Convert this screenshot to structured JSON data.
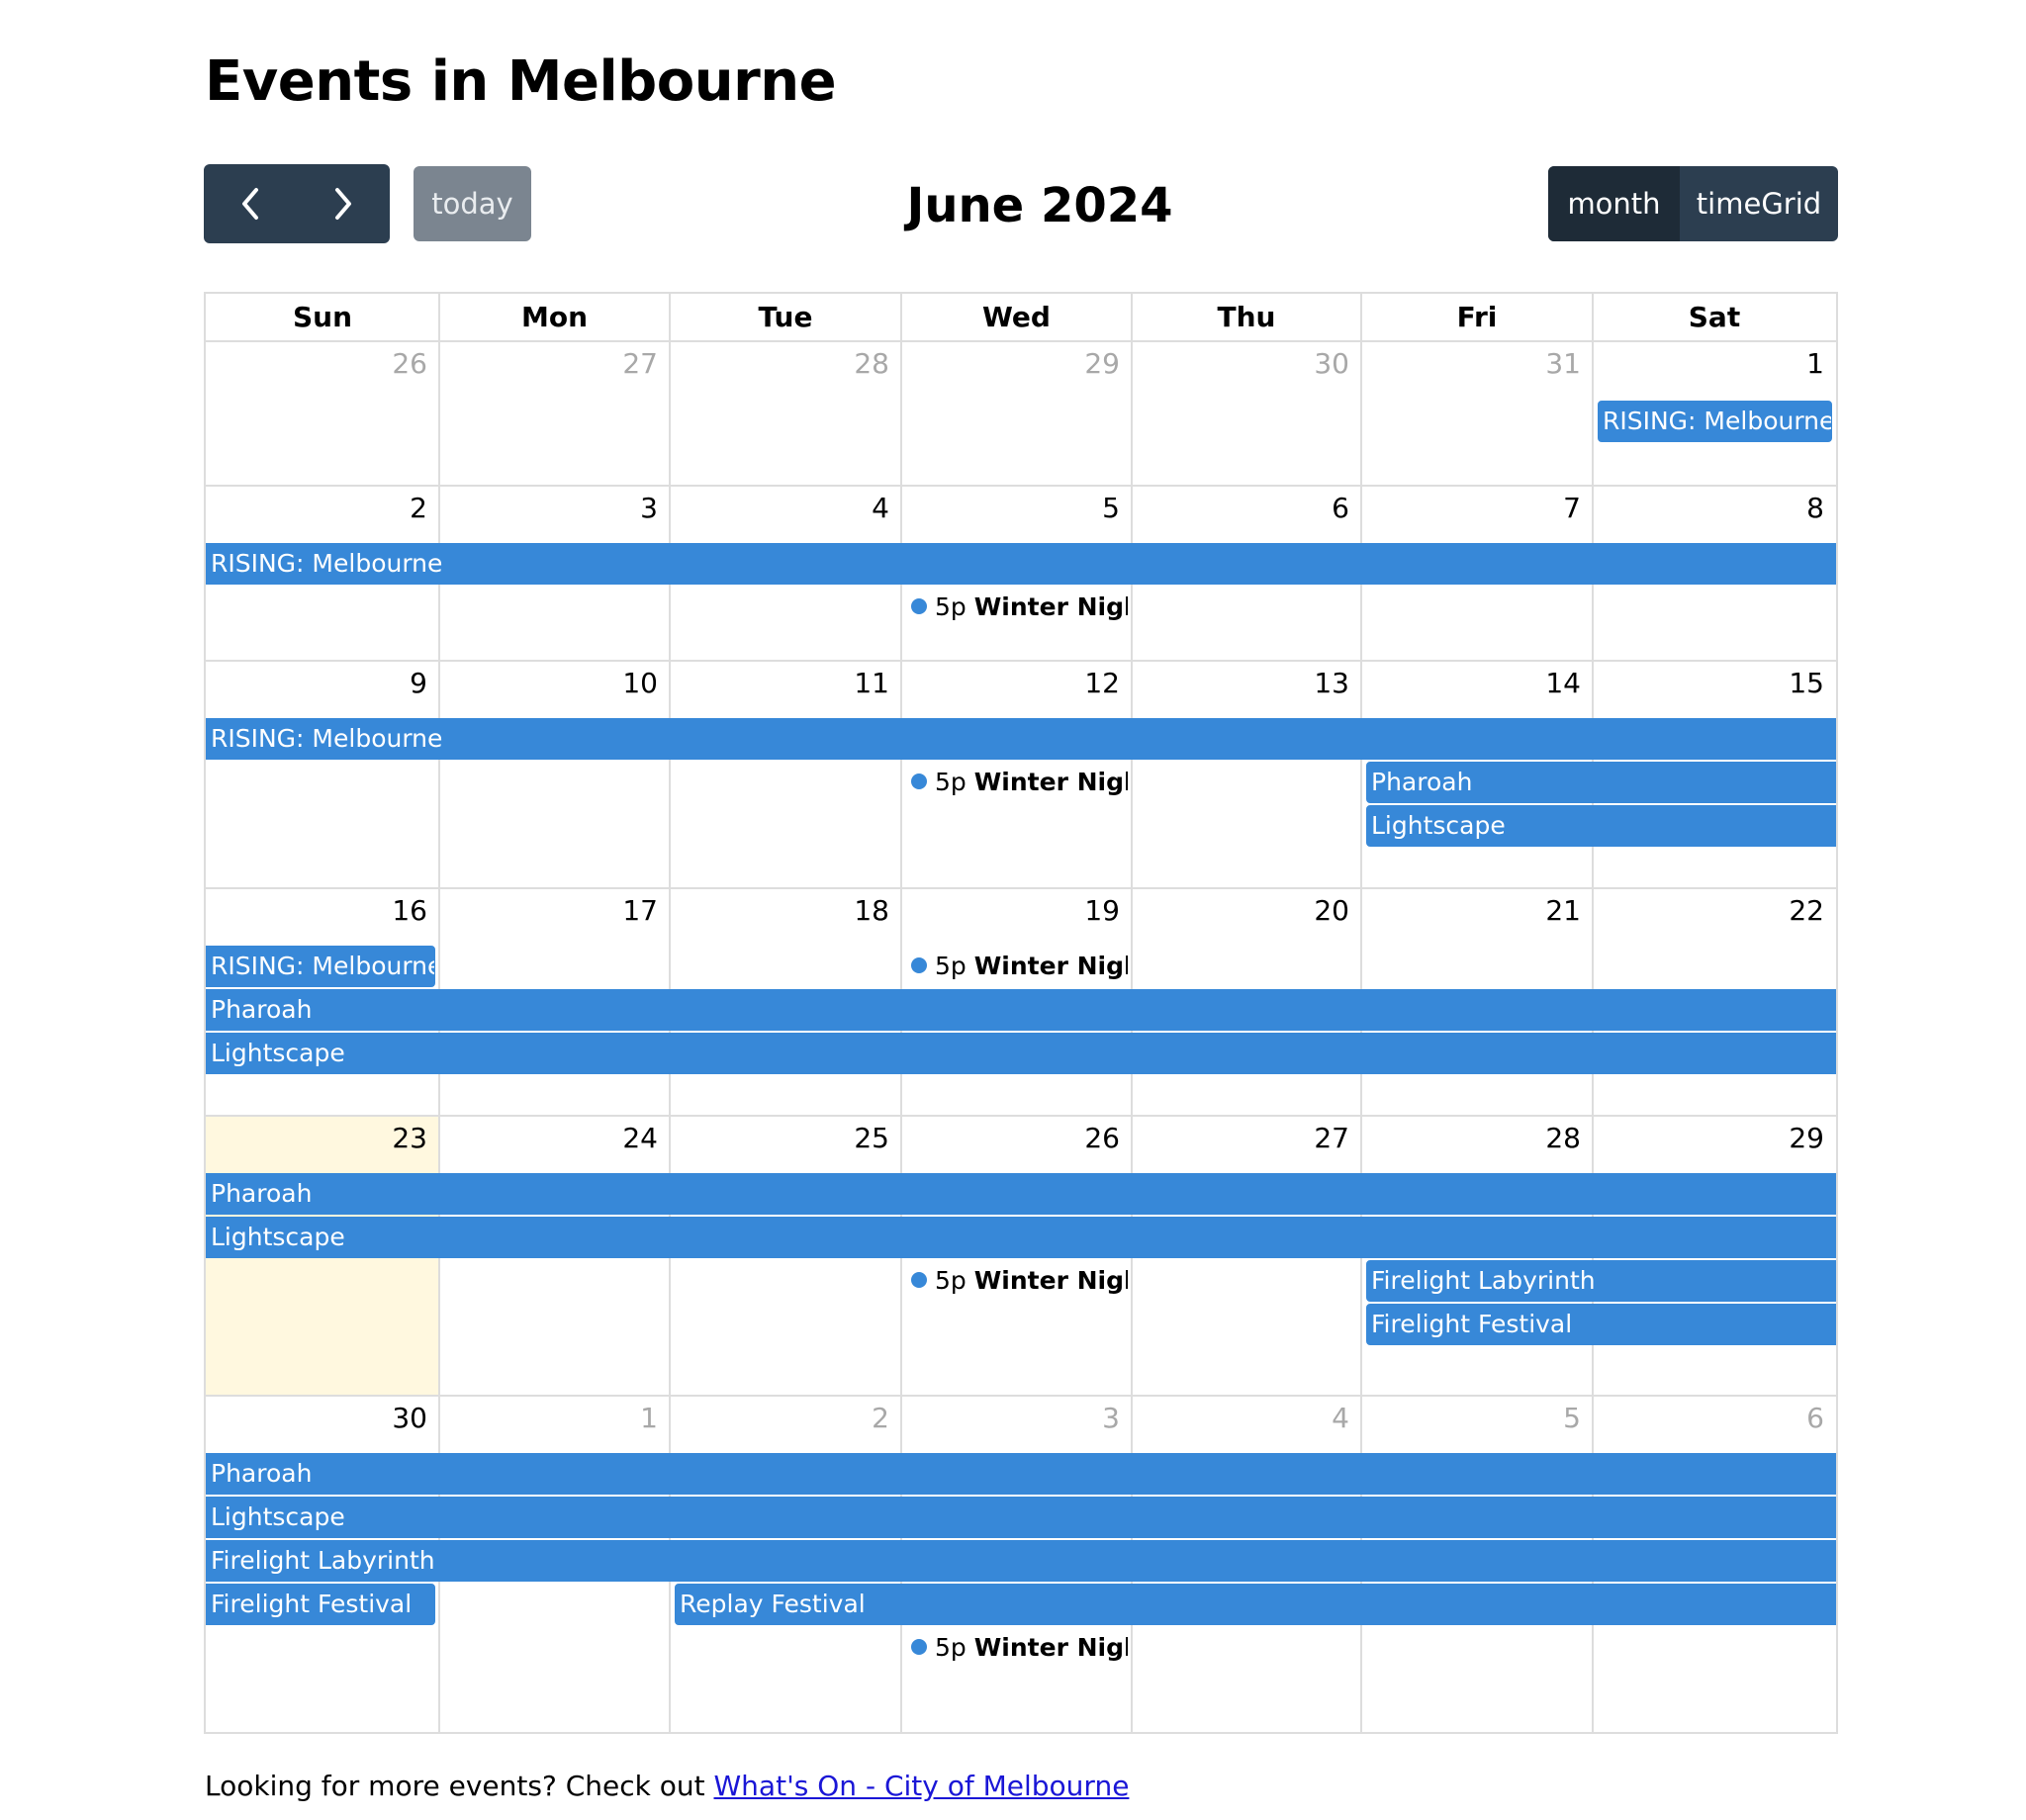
{
  "page": {
    "title": "Events in Melbourne"
  },
  "toolbar": {
    "prev_icon": "chevron-left-icon",
    "next_icon": "chevron-right-icon",
    "today_label": "today",
    "title": "June 2024",
    "views": [
      "month",
      "timeGrid"
    ],
    "active_view": "month"
  },
  "calendar": {
    "weekdays": [
      "Sun",
      "Mon",
      "Tue",
      "Wed",
      "Thu",
      "Fri",
      "Sat"
    ],
    "today": "2024-06-23",
    "weeks": [
      {
        "days": [
          {
            "n": "26",
            "other": true
          },
          {
            "n": "27",
            "other": true
          },
          {
            "n": "28",
            "other": true
          },
          {
            "n": "29",
            "other": true
          },
          {
            "n": "30",
            "other": true
          },
          {
            "n": "31",
            "other": true
          },
          {
            "n": "1"
          }
        ],
        "bars": [
          {
            "title": "RISING: Melbourne",
            "start": 6,
            "span": 1,
            "lane": 0,
            "rl": true,
            "rr": true
          }
        ],
        "dots": []
      },
      {
        "days": [
          {
            "n": "2"
          },
          {
            "n": "3"
          },
          {
            "n": "4"
          },
          {
            "n": "5"
          },
          {
            "n": "6"
          },
          {
            "n": "7"
          },
          {
            "n": "8"
          }
        ],
        "bars": [
          {
            "title": "RISING: Melbourne",
            "start": 0,
            "span": 7,
            "lane": 0
          }
        ],
        "dots": [
          {
            "time": "5p",
            "title": "Winter Night Market",
            "col": 3,
            "lane": 1
          }
        ]
      },
      {
        "days": [
          {
            "n": "9"
          },
          {
            "n": "10"
          },
          {
            "n": "11"
          },
          {
            "n": "12"
          },
          {
            "n": "13"
          },
          {
            "n": "14"
          },
          {
            "n": "15"
          }
        ],
        "bars": [
          {
            "title": "RISING: Melbourne",
            "start": 0,
            "span": 7,
            "lane": 0
          },
          {
            "title": "Pharoah",
            "start": 5,
            "span": 2,
            "lane": 1,
            "rl": true
          },
          {
            "title": "Lightscape",
            "start": 5,
            "span": 2,
            "lane": 2,
            "rl": true
          }
        ],
        "dots": [
          {
            "time": "5p",
            "title": "Winter Night Market",
            "col": 3,
            "lane": 1
          }
        ]
      },
      {
        "days": [
          {
            "n": "16"
          },
          {
            "n": "17"
          },
          {
            "n": "18"
          },
          {
            "n": "19"
          },
          {
            "n": "20"
          },
          {
            "n": "21"
          },
          {
            "n": "22"
          }
        ],
        "bars": [
          {
            "title": "RISING: Melbourne",
            "start": 0,
            "span": 1,
            "lane": 0,
            "rr": true
          },
          {
            "title": "Pharoah",
            "start": 0,
            "span": 7,
            "lane": 1
          },
          {
            "title": "Lightscape",
            "start": 0,
            "span": 7,
            "lane": 2
          }
        ],
        "dots": [
          {
            "time": "5p",
            "title": "Winter Night Market",
            "col": 3,
            "lane": 0
          }
        ]
      },
      {
        "days": [
          {
            "n": "23",
            "today": true
          },
          {
            "n": "24"
          },
          {
            "n": "25"
          },
          {
            "n": "26"
          },
          {
            "n": "27"
          },
          {
            "n": "28"
          },
          {
            "n": "29"
          }
        ],
        "bars": [
          {
            "title": "Pharoah",
            "start": 0,
            "span": 7,
            "lane": 0
          },
          {
            "title": "Lightscape",
            "start": 0,
            "span": 7,
            "lane": 1
          },
          {
            "title": "Firelight Labyrinth",
            "start": 5,
            "span": 2,
            "lane": 2,
            "rl": true
          },
          {
            "title": "Firelight Festival",
            "start": 5,
            "span": 2,
            "lane": 3,
            "rl": true
          }
        ],
        "dots": [
          {
            "time": "5p",
            "title": "Winter Night Market",
            "col": 3,
            "lane": 2
          }
        ]
      },
      {
        "days": [
          {
            "n": "30"
          },
          {
            "n": "1",
            "other": true
          },
          {
            "n": "2",
            "other": true
          },
          {
            "n": "3",
            "other": true
          },
          {
            "n": "4",
            "other": true
          },
          {
            "n": "5",
            "other": true
          },
          {
            "n": "6",
            "other": true
          }
        ],
        "bars": [
          {
            "title": "Pharoah",
            "start": 0,
            "span": 7,
            "lane": 0
          },
          {
            "title": "Lightscape",
            "start": 0,
            "span": 7,
            "lane": 1
          },
          {
            "title": "Firelight Labyrinth",
            "start": 0,
            "span": 7,
            "lane": 2
          },
          {
            "title": "Firelight Festival",
            "start": 0,
            "span": 1,
            "lane": 3,
            "rr": true
          },
          {
            "title": "Replay Festival",
            "start": 2,
            "span": 5,
            "lane": 3,
            "rl": true
          }
        ],
        "dots": [
          {
            "time": "5p",
            "title": "Winter Night Market",
            "col": 3,
            "lane": 4
          }
        ]
      }
    ]
  },
  "footer": {
    "text": "Looking for more events? Check out ",
    "link_text": "What's On - City of Melbourne"
  },
  "colors": {
    "event": "#3788d8",
    "today_bg": "#fff8df",
    "toolbar_btn": "#2c3e50",
    "today_btn": "#7b8590"
  }
}
